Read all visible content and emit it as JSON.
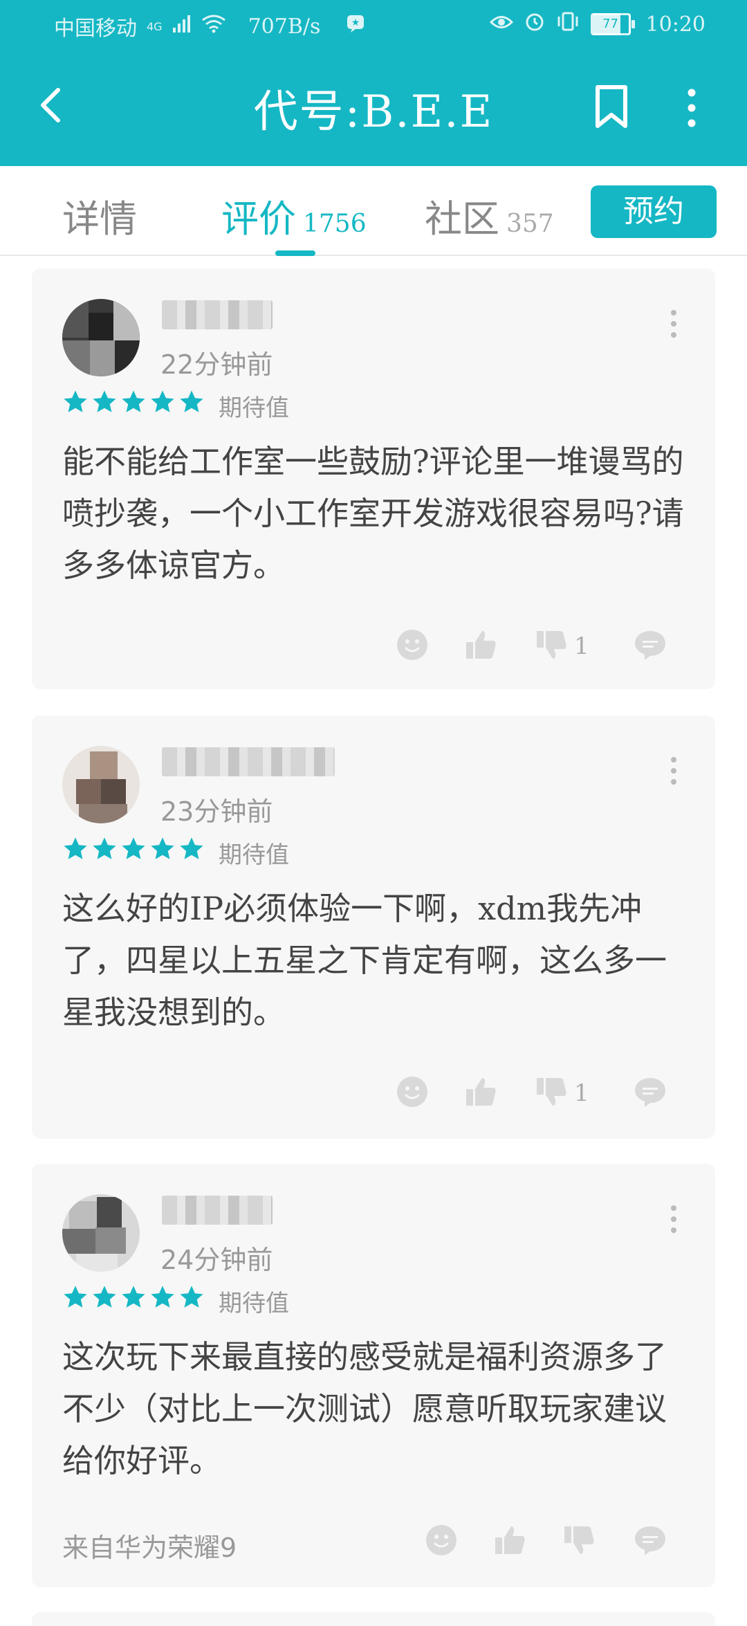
{
  "status_bar": {
    "carrier": "中国移动",
    "network": "4G",
    "speed": "707B/s",
    "battery": "77",
    "time": "10:20"
  },
  "app_bar": {
    "title": "代号:B.E.E"
  },
  "tabs": [
    {
      "label": "详情",
      "count": ""
    },
    {
      "label": "评价",
      "count": "1756"
    },
    {
      "label": "社区",
      "count": "357"
    }
  ],
  "reserve_button": "预约",
  "colors": {
    "accent": "#15b7c4",
    "star": "#15b7c4",
    "card": "#f7f7f7"
  },
  "reviews": [
    {
      "time": "22分钟前",
      "rating": 5,
      "rating_label": "期待值",
      "text": "能不能给工作室一些鼓励?评论里一堆谩骂的喷抄袭，一个小工作室开发游戏很容易吗?请多多体谅官方。",
      "dislike_count": "1",
      "device": ""
    },
    {
      "time": "23分钟前",
      "rating": 5,
      "rating_label": "期待值",
      "text": "这么好的IP必须体验一下啊，xdm我先冲了，四星以上五星之下肯定有啊，这么多一星我没想到的。",
      "dislike_count": "1",
      "device": ""
    },
    {
      "time": "24分钟前",
      "rating": 5,
      "rating_label": "期待值",
      "text": "这次玩下来最直接的感受就是福利资源多了不少（对比上一次测试）愿意听取玩家建议给你好评。",
      "dislike_count": "",
      "device": "来自华为荣耀9"
    }
  ]
}
